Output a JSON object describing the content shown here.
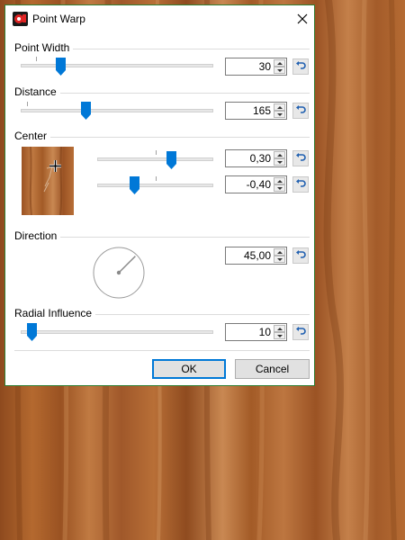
{
  "dialog": {
    "title": "Point Warp",
    "app_icon": "paint-app-icon",
    "close_icon": "close-icon"
  },
  "point_width": {
    "label": "Point Width",
    "value": "30",
    "slider_fraction": 0.21
  },
  "distance": {
    "label": "Distance",
    "value": "165",
    "slider_fraction": 0.34
  },
  "center": {
    "label": "Center",
    "x_value": "0,30",
    "y_value": "-0,40",
    "x_slider_fraction": 0.64,
    "y_slider_fraction": 0.32
  },
  "direction": {
    "label": "Direction",
    "value": "45,00",
    "angle_degrees": 45
  },
  "radial_influence": {
    "label": "Radial Influence",
    "value": "10",
    "slider_fraction": 0.06
  },
  "buttons": {
    "ok_label": "OK",
    "cancel_label": "Cancel"
  },
  "icons": {
    "reset": "reset-icon",
    "spin_up": "spin-up-icon",
    "spin_down": "spin-down-icon",
    "crosshair": "crosshair-icon"
  },
  "colors": {
    "accent": "#0078d7",
    "dialog_border": "#2f7d32",
    "wood_base": "#a45a28"
  }
}
